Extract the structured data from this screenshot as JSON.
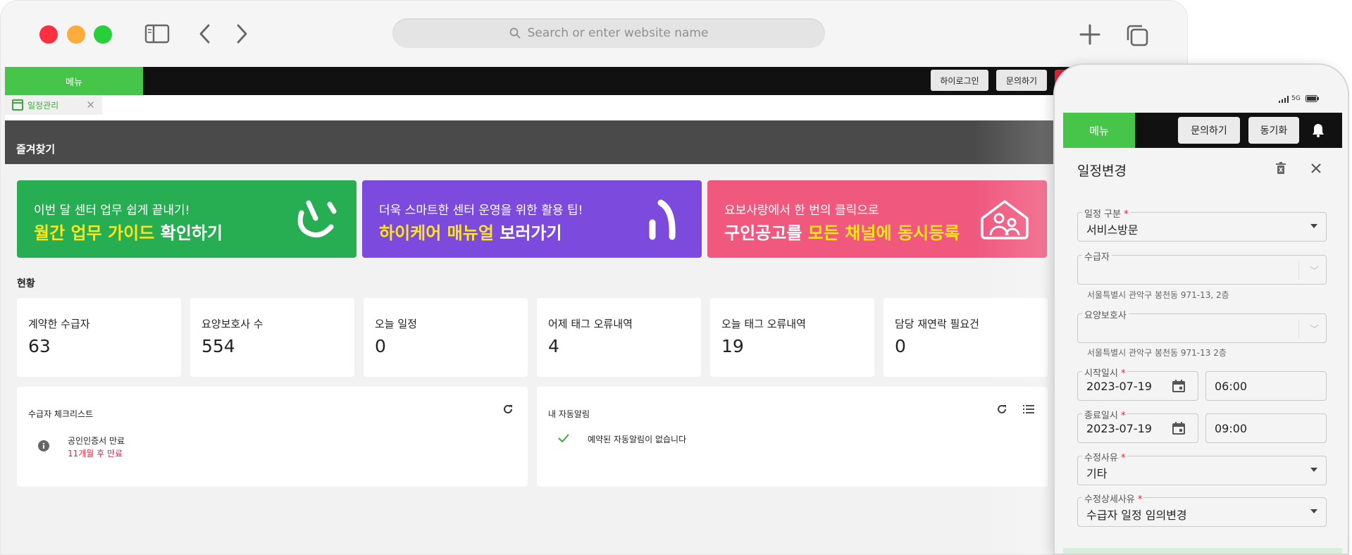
{
  "browser": {
    "address_placeholder": "Search or enter website name",
    "icons": [
      "sidebar-icon",
      "back-icon",
      "forward-icon",
      "search-icon",
      "new-tab-icon",
      "tabs-icon"
    ]
  },
  "app": {
    "menu_label": "메뉴",
    "top_buttons": [
      "하이로그인",
      "문의하기"
    ],
    "tab_label": "일정관리",
    "favorites_title": "즐겨찾기",
    "banners": [
      {
        "line1": "이번 달 센터 업무 쉽게 끝내기!",
        "line2_hl": "월간 업무 가이드",
        "line2_rest": " 확인하기",
        "color": "#27ad52"
      },
      {
        "line1": "더욱 스마트한 센터 운영을 위한 활용 팁!",
        "line2_hl": "하이케어 매뉴얼",
        "line2_rest": " 보러가기",
        "color": "#7c4bdd"
      },
      {
        "line1": "요보사랑에서 한 번의 클릭으로",
        "line2_pre": "구인공고를 ",
        "line2_hl": "모든 채널에 동시등록",
        "color": "#f0587e"
      }
    ],
    "status_title": "현황",
    "stats": [
      {
        "label": "계약한 수급자",
        "value": "63"
      },
      {
        "label": "요양보호사 수",
        "value": "554"
      },
      {
        "label": "오늘 일정",
        "value": "0"
      },
      {
        "label": "어제 태그 오류내역",
        "value": "4"
      },
      {
        "label": "오늘 태그 오류내역",
        "value": "19"
      },
      {
        "label": "담당 재연락 필요건",
        "value": "0"
      }
    ],
    "checklist": {
      "title": "수급자 체크리스트",
      "item_title": "공인인증서 만료",
      "item_sub": "11개월 후 만료"
    },
    "auto_alert": {
      "title": "내 자동알림",
      "empty": "예약된 자동알림이 없습니다"
    }
  },
  "phone": {
    "status": "5G",
    "menu_label": "메뉴",
    "buttons": [
      "문의하기",
      "동기화"
    ],
    "title": "일정변경",
    "fields": {
      "type": {
        "label": "일정 구분",
        "value": "서비스방문"
      },
      "recipient": {
        "label": "수급자",
        "value": "",
        "address": "서울특별시 관악구 봉천동 971-13, 2층"
      },
      "caregiver": {
        "label": "요양보호사",
        "value": "",
        "address": "서울특별시 관악구 봉천동 971-13 2층"
      },
      "start": {
        "label": "시작일시",
        "date": "2023-07-19",
        "time": "06:00"
      },
      "end": {
        "label": "종료일시",
        "date": "2023-07-19",
        "time": "09:00"
      },
      "reason": {
        "label": "수정사유",
        "value": "기타"
      },
      "detail": {
        "label": "수정상세사유",
        "value": "수급자 일정 임의변경"
      }
    },
    "required_mark": "*"
  },
  "colors": {
    "green": "#47c44a",
    "red": "#e8213a",
    "yellow": "#ffe61a"
  }
}
